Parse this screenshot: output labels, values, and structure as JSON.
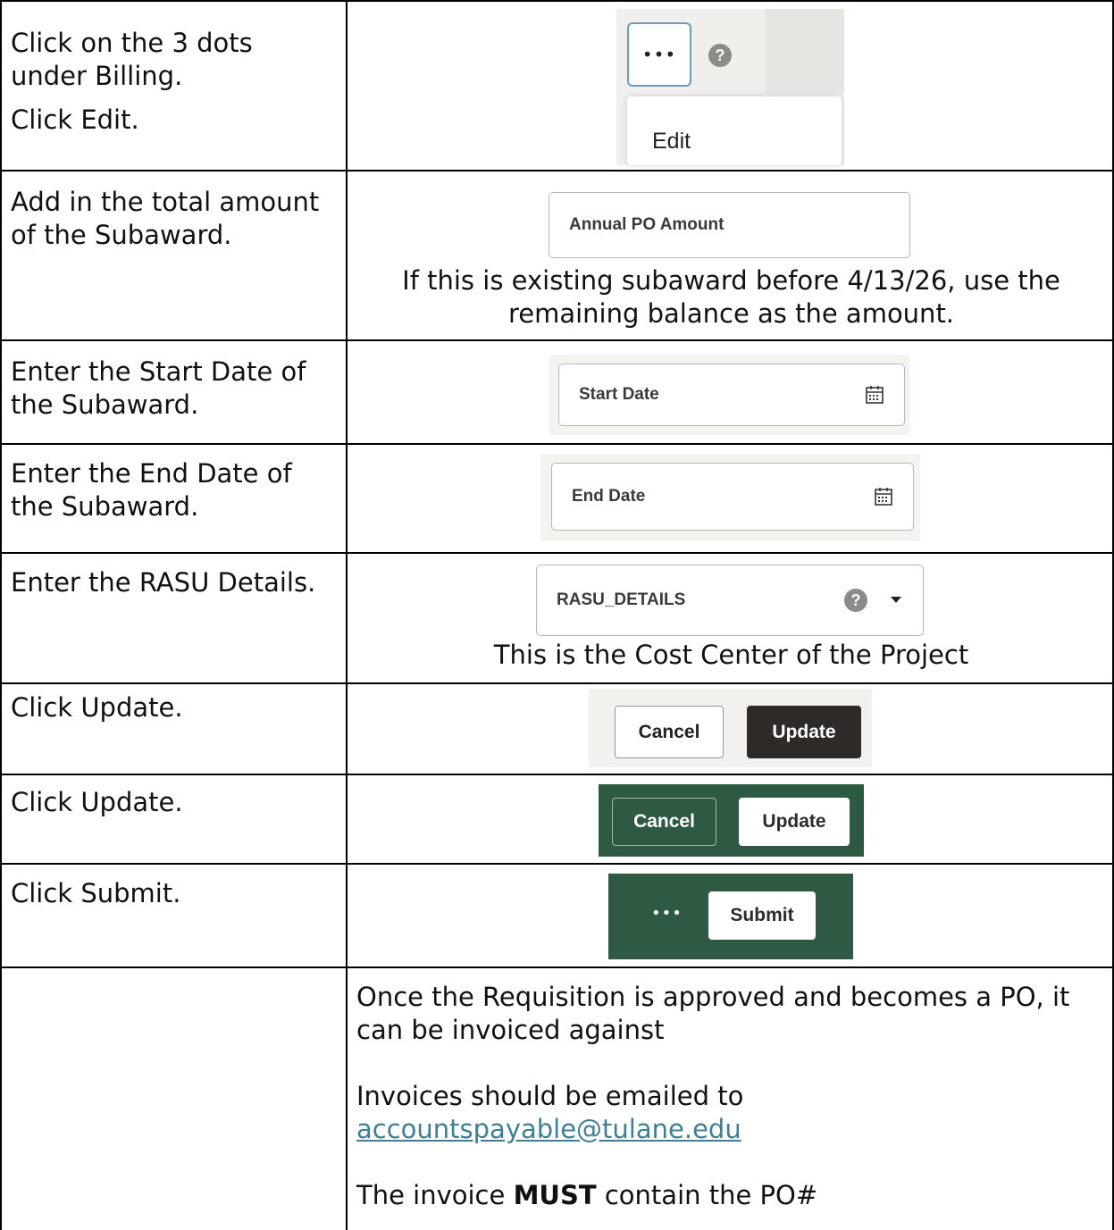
{
  "rows": [
    {
      "instruction_line1": "Click on the 3 dots under Billing.",
      "instruction_line2": "Click Edit.",
      "dots_glyph": "•••",
      "help_glyph": "?",
      "menu_item": "Edit"
    },
    {
      "instruction": "Add in the total amount of the Subaward.",
      "field_label": "Annual PO Amount",
      "caption": "If this is existing subaward before 4/13/26, use the remaining balance as the amount."
    },
    {
      "instruction": "Enter the Start Date of the Subaward.",
      "field_label": "Start Date",
      "icon": "calendar-icon"
    },
    {
      "instruction": "Enter the End Date of the Subaward.",
      "field_label": "End Date",
      "icon": "calendar-icon"
    },
    {
      "instruction": "Enter the RASU Details.",
      "field_label": "RASU_DETAILS",
      "help_glyph": "?",
      "caption": "This is the Cost Center of the Project"
    },
    {
      "instruction": "Click Update.",
      "cancel_label": "Cancel",
      "update_label": "Update"
    },
    {
      "instruction": "Click Update.",
      "cancel_label": "Cancel",
      "update_label": "Update",
      "bar_color": "#2e5a44"
    },
    {
      "instruction": "Click Submit.",
      "dots_glyph": "•••",
      "submit_label": "Submit",
      "bar_color": "#2e5a44"
    }
  ],
  "final": {
    "paragraph1": "Once the Requisition is approved and becomes a PO, it can be invoiced against",
    "paragraph2": "Invoices should be emailed to",
    "email": "accountspayable@tulane.edu",
    "paragraph3_before": "The invoice ",
    "paragraph3_bold": "MUST",
    "paragraph3_after": " contain the PO#"
  },
  "colors": {
    "link": "#3f7f93",
    "dark_button": "#2d2a28",
    "green_bar": "#2e5a44",
    "help_grey": "#8d8b88"
  }
}
